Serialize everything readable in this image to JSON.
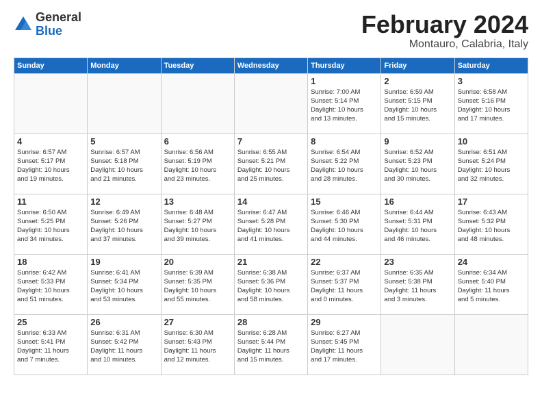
{
  "header": {
    "logo_general": "General",
    "logo_blue": "Blue",
    "month_title": "February 2024",
    "location": "Montauro, Calabria, Italy"
  },
  "days_of_week": [
    "Sunday",
    "Monday",
    "Tuesday",
    "Wednesday",
    "Thursday",
    "Friday",
    "Saturday"
  ],
  "weeks": [
    [
      {
        "num": "",
        "info": ""
      },
      {
        "num": "",
        "info": ""
      },
      {
        "num": "",
        "info": ""
      },
      {
        "num": "",
        "info": ""
      },
      {
        "num": "1",
        "info": "Sunrise: 7:00 AM\nSunset: 5:14 PM\nDaylight: 10 hours\nand 13 minutes."
      },
      {
        "num": "2",
        "info": "Sunrise: 6:59 AM\nSunset: 5:15 PM\nDaylight: 10 hours\nand 15 minutes."
      },
      {
        "num": "3",
        "info": "Sunrise: 6:58 AM\nSunset: 5:16 PM\nDaylight: 10 hours\nand 17 minutes."
      }
    ],
    [
      {
        "num": "4",
        "info": "Sunrise: 6:57 AM\nSunset: 5:17 PM\nDaylight: 10 hours\nand 19 minutes."
      },
      {
        "num": "5",
        "info": "Sunrise: 6:57 AM\nSunset: 5:18 PM\nDaylight: 10 hours\nand 21 minutes."
      },
      {
        "num": "6",
        "info": "Sunrise: 6:56 AM\nSunset: 5:19 PM\nDaylight: 10 hours\nand 23 minutes."
      },
      {
        "num": "7",
        "info": "Sunrise: 6:55 AM\nSunset: 5:21 PM\nDaylight: 10 hours\nand 25 minutes."
      },
      {
        "num": "8",
        "info": "Sunrise: 6:54 AM\nSunset: 5:22 PM\nDaylight: 10 hours\nand 28 minutes."
      },
      {
        "num": "9",
        "info": "Sunrise: 6:52 AM\nSunset: 5:23 PM\nDaylight: 10 hours\nand 30 minutes."
      },
      {
        "num": "10",
        "info": "Sunrise: 6:51 AM\nSunset: 5:24 PM\nDaylight: 10 hours\nand 32 minutes."
      }
    ],
    [
      {
        "num": "11",
        "info": "Sunrise: 6:50 AM\nSunset: 5:25 PM\nDaylight: 10 hours\nand 34 minutes."
      },
      {
        "num": "12",
        "info": "Sunrise: 6:49 AM\nSunset: 5:26 PM\nDaylight: 10 hours\nand 37 minutes."
      },
      {
        "num": "13",
        "info": "Sunrise: 6:48 AM\nSunset: 5:27 PM\nDaylight: 10 hours\nand 39 minutes."
      },
      {
        "num": "14",
        "info": "Sunrise: 6:47 AM\nSunset: 5:28 PM\nDaylight: 10 hours\nand 41 minutes."
      },
      {
        "num": "15",
        "info": "Sunrise: 6:46 AM\nSunset: 5:30 PM\nDaylight: 10 hours\nand 44 minutes."
      },
      {
        "num": "16",
        "info": "Sunrise: 6:44 AM\nSunset: 5:31 PM\nDaylight: 10 hours\nand 46 minutes."
      },
      {
        "num": "17",
        "info": "Sunrise: 6:43 AM\nSunset: 5:32 PM\nDaylight: 10 hours\nand 48 minutes."
      }
    ],
    [
      {
        "num": "18",
        "info": "Sunrise: 6:42 AM\nSunset: 5:33 PM\nDaylight: 10 hours\nand 51 minutes."
      },
      {
        "num": "19",
        "info": "Sunrise: 6:41 AM\nSunset: 5:34 PM\nDaylight: 10 hours\nand 53 minutes."
      },
      {
        "num": "20",
        "info": "Sunrise: 6:39 AM\nSunset: 5:35 PM\nDaylight: 10 hours\nand 55 minutes."
      },
      {
        "num": "21",
        "info": "Sunrise: 6:38 AM\nSunset: 5:36 PM\nDaylight: 10 hours\nand 58 minutes."
      },
      {
        "num": "22",
        "info": "Sunrise: 6:37 AM\nSunset: 5:37 PM\nDaylight: 11 hours\nand 0 minutes."
      },
      {
        "num": "23",
        "info": "Sunrise: 6:35 AM\nSunset: 5:38 PM\nDaylight: 11 hours\nand 3 minutes."
      },
      {
        "num": "24",
        "info": "Sunrise: 6:34 AM\nSunset: 5:40 PM\nDaylight: 11 hours\nand 5 minutes."
      }
    ],
    [
      {
        "num": "25",
        "info": "Sunrise: 6:33 AM\nSunset: 5:41 PM\nDaylight: 11 hours\nand 7 minutes."
      },
      {
        "num": "26",
        "info": "Sunrise: 6:31 AM\nSunset: 5:42 PM\nDaylight: 11 hours\nand 10 minutes."
      },
      {
        "num": "27",
        "info": "Sunrise: 6:30 AM\nSunset: 5:43 PM\nDaylight: 11 hours\nand 12 minutes."
      },
      {
        "num": "28",
        "info": "Sunrise: 6:28 AM\nSunset: 5:44 PM\nDaylight: 11 hours\nand 15 minutes."
      },
      {
        "num": "29",
        "info": "Sunrise: 6:27 AM\nSunset: 5:45 PM\nDaylight: 11 hours\nand 17 minutes."
      },
      {
        "num": "",
        "info": ""
      },
      {
        "num": "",
        "info": ""
      }
    ]
  ]
}
